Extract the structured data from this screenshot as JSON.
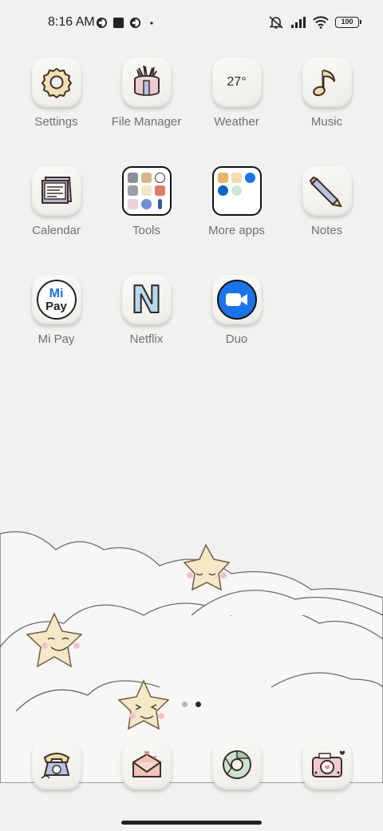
{
  "status": {
    "time": "8:16 AM",
    "battery": "100",
    "icons": [
      "app-notification-icon",
      "square-notification-icon",
      "app-notification-icon",
      "dot-icon",
      "mute-icon",
      "signal-icon",
      "wifi-icon",
      "battery-icon"
    ]
  },
  "apps": [
    {
      "label": "Settings",
      "icon": "gear-icon"
    },
    {
      "label": "File Manager",
      "icon": "folder-box-icon"
    },
    {
      "label": "Weather",
      "icon": "weather-icon",
      "temp": "27°"
    },
    {
      "label": "Music",
      "icon": "music-note-icon"
    },
    {
      "label": "Calendar",
      "icon": "calendar-icon"
    },
    {
      "label": "Tools",
      "icon": "folder-icon"
    },
    {
      "label": "More apps",
      "icon": "folder-icon"
    },
    {
      "label": "Notes",
      "icon": "pencil-icon"
    },
    {
      "label": "Mi Pay",
      "icon": "mipay-icon",
      "logo_top": "Mi",
      "logo_bottom": "Pay"
    },
    {
      "label": "Netflix",
      "icon": "netflix-icon",
      "logo": "N"
    },
    {
      "label": "Duo",
      "icon": "video-camera-icon"
    }
  ],
  "dock": [
    {
      "icon": "phone-icon"
    },
    {
      "icon": "envelope-icon"
    },
    {
      "icon": "chrome-icon"
    },
    {
      "icon": "camera-icon"
    }
  ],
  "page_indicator": {
    "count": 2,
    "active": 2
  },
  "colors": {
    "background": "#f2f1ef",
    "duo_blue": "#1a73e8",
    "label_gray": "#707070"
  }
}
